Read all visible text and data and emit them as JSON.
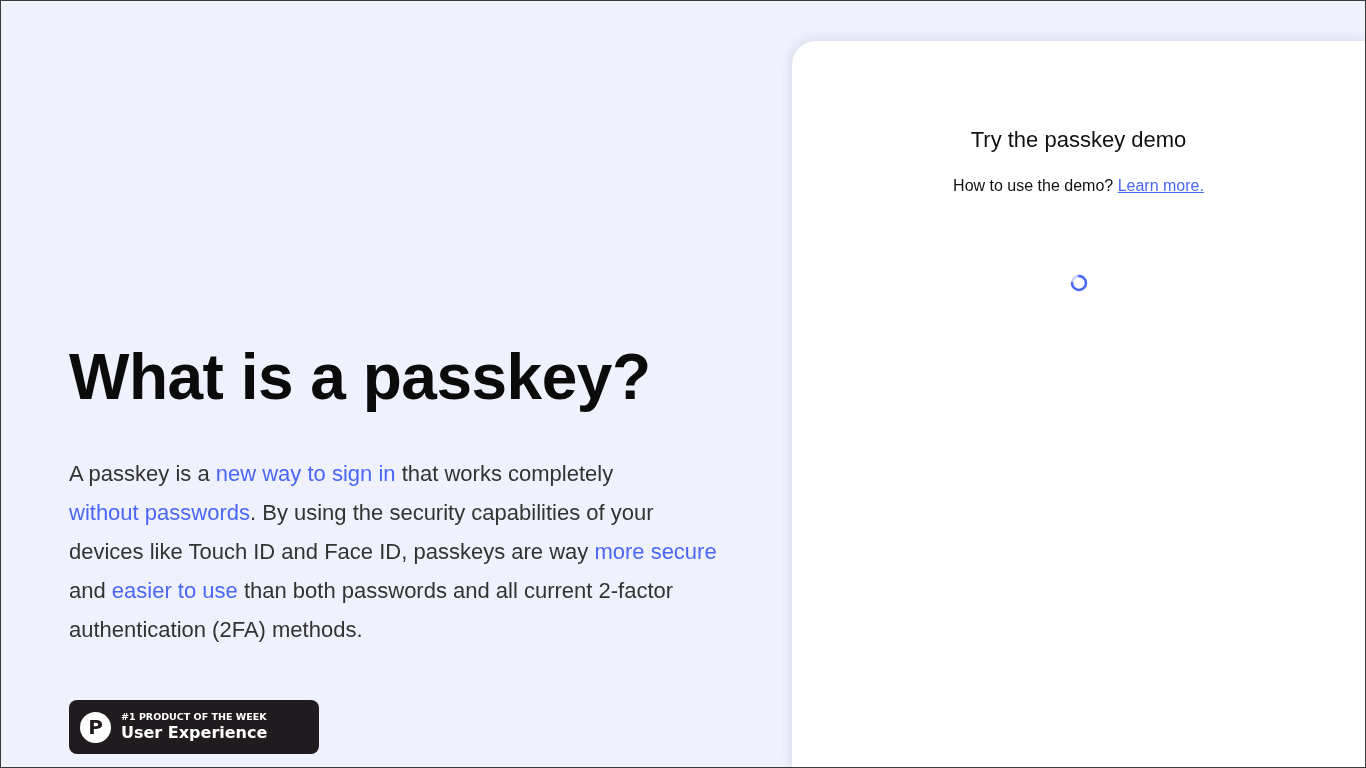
{
  "hero": {
    "title": "What is a passkey?",
    "paragraph": [
      {
        "kind": "text",
        "text": "A passkey is a "
      },
      {
        "kind": "link",
        "text": "new way to sign in"
      },
      {
        "kind": "text",
        "text": " that works completely "
      },
      {
        "kind": "link",
        "text": "without passwords"
      },
      {
        "kind": "text",
        "text": ". By using the security capabilities of your devices like Touch ID and Face ID, passkeys are way "
      },
      {
        "kind": "link",
        "text": "more secure"
      },
      {
        "kind": "text",
        "text": " and "
      },
      {
        "kind": "link",
        "text": "easier to use"
      },
      {
        "kind": "text",
        "text": " than both passwords and all current 2-factor authentication (2FA) methods."
      }
    ],
    "badge": {
      "logo_letter": "P",
      "eyebrow": "#1 PRODUCT OF THE WEEK",
      "title": "User Experience"
    }
  },
  "demo": {
    "title": "Try the passkey demo",
    "help_text": "How to use the demo?",
    "help_link": "Learn more.",
    "loading": true
  }
}
